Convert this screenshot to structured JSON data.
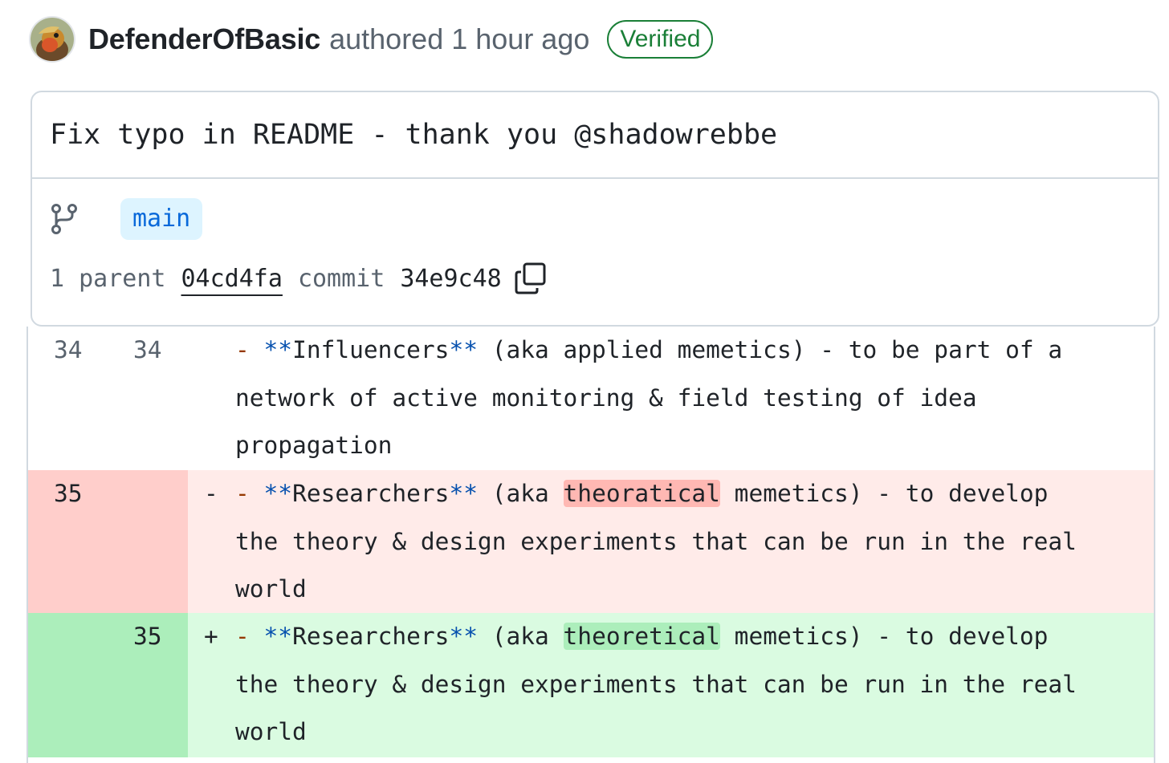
{
  "header": {
    "author": "DefenderOfBasic",
    "authored_text": "authored 1 hour ago",
    "badge": "Verified"
  },
  "commit": {
    "title": "Fix typo in README - thank you @shadowrebbe",
    "branch": "main",
    "parent_label": "1 parent",
    "parent_sha": "04cd4fa",
    "commit_label": "commit",
    "commit_sha": "34e9c48"
  },
  "diff": {
    "context": {
      "old_num": "34",
      "new_num": "34",
      "dash": "-",
      "bold_open": "**",
      "word": "Influencers",
      "bold_close": "**",
      "line1_rest": " (aka applied memetics) - to be part of a",
      "line2": "network of active monitoring & field testing of idea",
      "line3": "propagation"
    },
    "deleted": {
      "old_num": "35",
      "marker": "-",
      "dash": "-",
      "bold_open": "**",
      "word": "Researchers",
      "bold_close": "**",
      "pre": " (aka ",
      "changed": "theoratical",
      "post": " memetics) - to develop",
      "line2": "the theory & design experiments that can be run in the real",
      "line3": "world"
    },
    "added": {
      "new_num": "35",
      "marker": "+",
      "dash": "-",
      "bold_open": "**",
      "word": "Researchers",
      "bold_close": "**",
      "pre": " (aka ",
      "changed": "theoretical",
      "post": " memetics) - to develop",
      "line2": "the theory & design experiments that can be run in the real",
      "line3": "world"
    }
  },
  "colors": {
    "verified_green": "#1a7f37",
    "branch_blue": "#0969da",
    "deletion_bg": "#ffebe9",
    "addition_bg": "#dafbe1"
  },
  "icons": {
    "branch": "git-branch-icon",
    "copy": "copy-icon"
  }
}
